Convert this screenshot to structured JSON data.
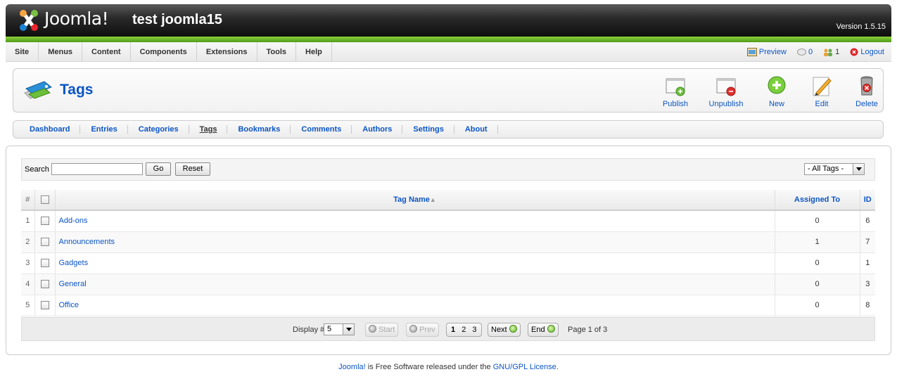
{
  "header": {
    "logo_text": "Joomla!",
    "site_name": "test joomla15",
    "version": "Version 1.5.15"
  },
  "menubar": {
    "items": [
      "Site",
      "Menus",
      "Content",
      "Components",
      "Extensions",
      "Tools",
      "Help"
    ],
    "status": {
      "preview": "Preview",
      "messages": "0",
      "users": "1",
      "logout": "Logout"
    }
  },
  "toolbar": {
    "title": "Tags",
    "buttons": {
      "publish": "Publish",
      "unpublish": "Unpublish",
      "new": "New",
      "edit": "Edit",
      "delete": "Delete"
    }
  },
  "submenu": {
    "items": [
      "Dashboard",
      "Entries",
      "Categories",
      "Tags",
      "Bookmarks",
      "Comments",
      "Authors",
      "Settings",
      "About"
    ],
    "active": "Tags"
  },
  "filter": {
    "search_label": "Search",
    "search_value": "",
    "go": "Go",
    "reset": "Reset",
    "tag_filter_selected": "- All Tags -"
  },
  "table": {
    "headers": {
      "num": "#",
      "name": "Tag Name",
      "sort_indicator": "▲",
      "assigned": "Assigned To",
      "id": "ID"
    },
    "rows": [
      {
        "num": "1",
        "name": "Add-ons",
        "assigned": "0",
        "id": "6"
      },
      {
        "num": "2",
        "name": "Announcements",
        "assigned": "1",
        "id": "7"
      },
      {
        "num": "3",
        "name": "Gadgets",
        "assigned": "0",
        "id": "1"
      },
      {
        "num": "4",
        "name": "General",
        "assigned": "0",
        "id": "3"
      },
      {
        "num": "5",
        "name": "Office",
        "assigned": "0",
        "id": "8"
      }
    ]
  },
  "pagination": {
    "display_label": "Display #",
    "limit": "5",
    "start": "Start",
    "prev": "Prev",
    "pages": [
      "1",
      "2",
      "3"
    ],
    "next": "Next",
    "end": "End",
    "page_info": "Page 1 of 3"
  },
  "footer": {
    "joomla_link": "Joomla!",
    "text": " is Free Software released under the ",
    "license_link": "GNU/GPL License",
    "period": "."
  },
  "colors": {
    "link": "#0b55c4",
    "header_green": "#6cb52a",
    "header_dark": "#1a1a1a"
  }
}
